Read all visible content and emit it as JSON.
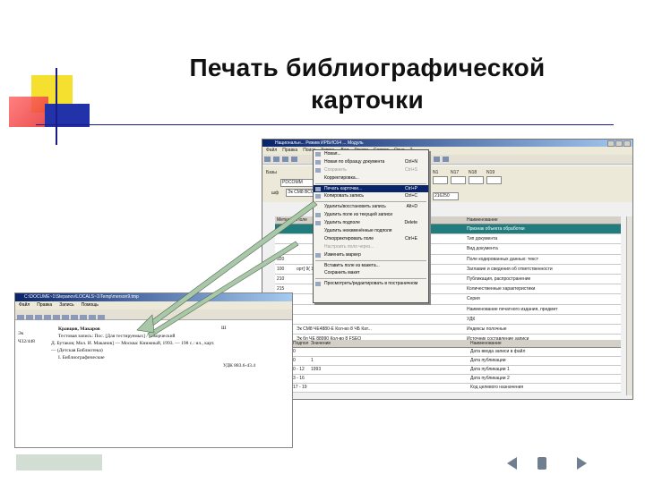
{
  "slide": {
    "title_line1": "Печать библиографической",
    "title_line2": "карточки"
  },
  "colors": {
    "logo_yellow": "#f5e030",
    "logo_red": "#e83030",
    "logo_blue": "#2233aa",
    "rule": "#1a1a8a",
    "menu_highlight": "#0a246a",
    "grid_selected": "#1f7d7d",
    "arrow": "#a8c8a8"
  },
  "main_window": {
    "title": "Национальн... Режим ИРБИС64 ... Модуль",
    "menu": [
      "Файл",
      "Правка",
      "Поиск",
      "Запись",
      "Вид",
      "Режим",
      "Сервис",
      "Окна",
      "?"
    ],
    "form": {
      "db_label": "Базы",
      "db_value": "PDCOMM",
      "search_label": "шф",
      "search_value": "Эк СМ8 ВСС",
      "small_cols": [
        "N1",
        "N17",
        "N18",
        "N19"
      ],
      "small_value": "216250"
    },
    "grid_header": [
      "Метка",
      "Поле",
      "Наименование"
    ],
    "grid_rows": [
      {
        "tag": "",
        "value": "",
        "name": "Признак объекта обработки",
        "selected": true
      },
      {
        "tag": "",
        "value": "",
        "name": "Тип документа",
        "selected": false
      },
      {
        "tag": "",
        "value": "",
        "name": "Вид документа",
        "selected": false
      },
      {
        "tag": "920",
        "value": "",
        "name": "Поле кодированных данных: текст",
        "selected": false
      },
      {
        "tag": "100",
        "value": "орт] 9( Уч...",
        "name": "Заглавие и сведения об ответственности",
        "selected": false
      },
      {
        "tag": "210",
        "value": "",
        "name": "Публикация, распространение",
        "selected": false
      },
      {
        "tag": "215",
        "value": "",
        "name": "Количественные характеристики",
        "selected": false
      },
      {
        "tag": "225",
        "value": "",
        "name": "Серия",
        "selected": false
      },
      {
        "tag": "225",
        "value": "",
        "name": "Наименование печатного издания, предмет",
        "selected": false
      },
      {
        "tag": "",
        "value": "",
        "name": "УДК",
        "selected": false
      },
      {
        "tag": "",
        "value": "Эк СМ8 ЧЕ4880-Е Кол-во 8 ЧБ Кат...",
        "name": "Индексы полочные",
        "selected": false
      },
      {
        "tag": "",
        "value": "Эк бп ЧЕ 88990 Кол-во 8 FSEO",
        "name": "Источник составление записи",
        "selected": false
      },
      {
        "tag": "",
        "value": "Эк СМ8 ЧЕ 5ЧЕ4 81 РЕ",
        "name": "Ценные экземпляры",
        "selected": false
      },
      {
        "tag": "",
        "value": "Эк СМ8 ЧЕ4 81 РЕ",
        "name": "Ценные экземпляры",
        "selected": false
      }
    ],
    "grid2_header": [
      "Подпол",
      "Значение",
      "Наименование"
    ],
    "grid2_rows": [
      {
        "tag": "0",
        "value": "",
        "name": "Дата ввода записи в файл"
      },
      {
        "tag": "0",
        "value": "1",
        "name": "Дата публикации"
      },
      {
        "tag": "0 - 12",
        "value": "1993",
        "name": "Дата публикации 1"
      },
      {
        "tag": "3 - 16",
        "value": "",
        "name": "Дата публикации 2"
      },
      {
        "tag": "17 - 19",
        "value": "",
        "name": "Код целевого назначения"
      }
    ]
  },
  "dropdown_menu": {
    "items": [
      {
        "label": "Новая...",
        "shortcut": "",
        "state": "normal",
        "icon": "new-record-icon"
      },
      {
        "label": "Новая по образцу документа",
        "shortcut": "Ctrl+N",
        "state": "normal",
        "icon": "copy-record-icon"
      },
      {
        "label": "Сохранить",
        "shortcut": "Ctrl+S",
        "state": "disabled",
        "icon": "save-icon"
      },
      {
        "label": "Корректировка...",
        "shortcut": "",
        "state": "normal",
        "icon": ""
      },
      {
        "sep": true
      },
      {
        "label": "Печать карточки...",
        "shortcut": "Ctrl+P",
        "state": "highlight",
        "icon": "print-icon"
      },
      {
        "label": "Копировать запись",
        "shortcut": "Ctrl+C",
        "state": "normal",
        "icon": "copy-icon"
      },
      {
        "sep": true
      },
      {
        "label": "Удалить/восстановить запись",
        "shortcut": "Alt+D",
        "state": "normal",
        "icon": ""
      },
      {
        "label": "Удалить поле из текущей записи",
        "shortcut": "",
        "state": "normal",
        "icon": "delete-icon"
      },
      {
        "label": "Удалить подполе",
        "shortcut": "Delete",
        "state": "normal",
        "icon": "delete-x-icon"
      },
      {
        "label": "Удалить неизменённые подполя",
        "shortcut": "",
        "state": "normal",
        "icon": ""
      },
      {
        "label": "Откорректировать поле",
        "shortcut": "Ctrl+E",
        "state": "normal",
        "icon": ""
      },
      {
        "label": "Настроить поля через...",
        "shortcut": "",
        "state": "disabled",
        "icon": ""
      },
      {
        "label": "Изменить маркер",
        "shortcut": "",
        "state": "normal",
        "icon": "marker-icon"
      },
      {
        "sep": true
      },
      {
        "label": "Вставить поле из макета...",
        "shortcut": "",
        "state": "normal",
        "icon": ""
      },
      {
        "label": "Сохранить макет",
        "shortcut": "",
        "state": "normal",
        "icon": ""
      },
      {
        "sep": true
      },
      {
        "label": "Просмотреть/редактировать в постраничном",
        "shortcut": "",
        "state": "normal",
        "icon": "view-icon"
      }
    ]
  },
  "preview_window": {
    "title": "C:\\DOCUME~1\\Stepanov\\LOCALS~1\\Temp\\merson9.tmp",
    "menu": [
      "Файл",
      "Правка",
      "Запись",
      "Помощь"
    ],
    "card": {
      "corner": "Эк",
      "call_number": "Ч32/448",
      "author": "Кравцов, Макаров",
      "line1": "Тестовая запись: Пос. [Для тестируемых] / [Творческий",
      "line2": "Д. Бутаков; Мол. И. Маканов] — Москва: Книжный, 1993. — 198 с.: ил., карт.",
      "line3": "— (Детская Библиотека)",
      "line4": "I. Библиографические",
      "right_top": "Ш",
      "udk": "УДК 883.6-43.4"
    }
  }
}
